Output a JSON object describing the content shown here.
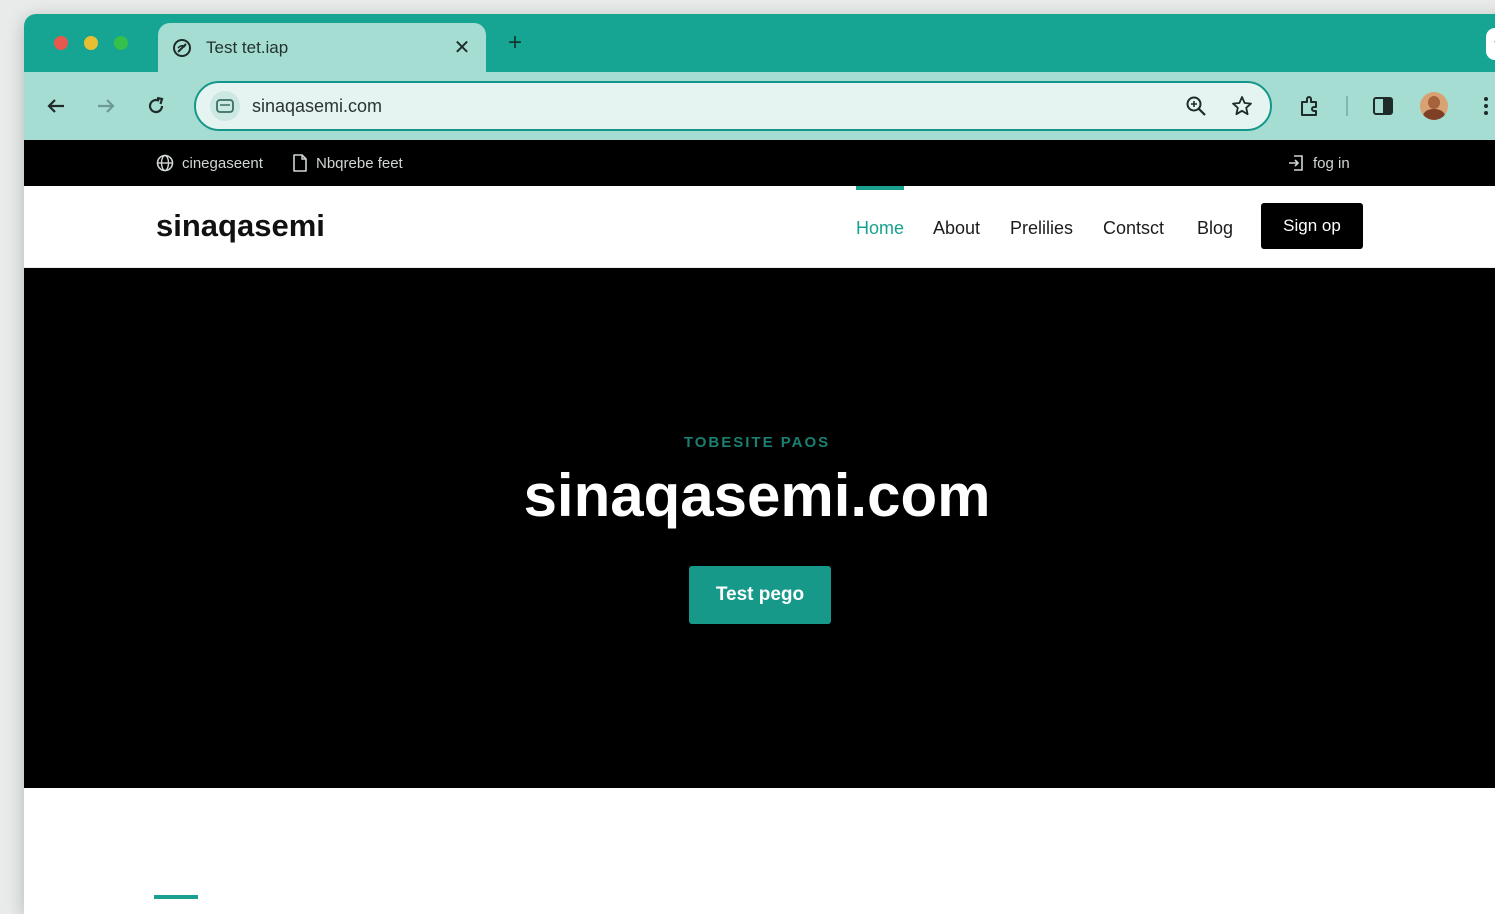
{
  "browser": {
    "tab": {
      "title": "Test tet.iap",
      "favicon": "globe-icon"
    },
    "address_bar": {
      "url": "sinaqasemi.com"
    }
  },
  "site": {
    "topbar": {
      "left_items": [
        {
          "icon": "globe-icon",
          "label": "cinegaseent"
        },
        {
          "icon": "document-icon",
          "label": "Nbqrebe feet"
        }
      ],
      "login": {
        "icon": "login-icon",
        "label": "fog in"
      }
    },
    "brand": "sinaqasemi",
    "nav": {
      "items": [
        "Home",
        "About",
        "Prelilies",
        "Contsct",
        "Blog"
      ],
      "active": "Home",
      "signup_label": "Sign op"
    },
    "hero": {
      "eyebrow": "TOBESITE PAOS",
      "title": "sinaqasemi.com",
      "button_label": "Test pego"
    }
  },
  "colors": {
    "accent": "#1aa08f",
    "tabstrip": "#17a593",
    "toolbar": "#a6ddd3",
    "hero_bg": "#000000"
  }
}
